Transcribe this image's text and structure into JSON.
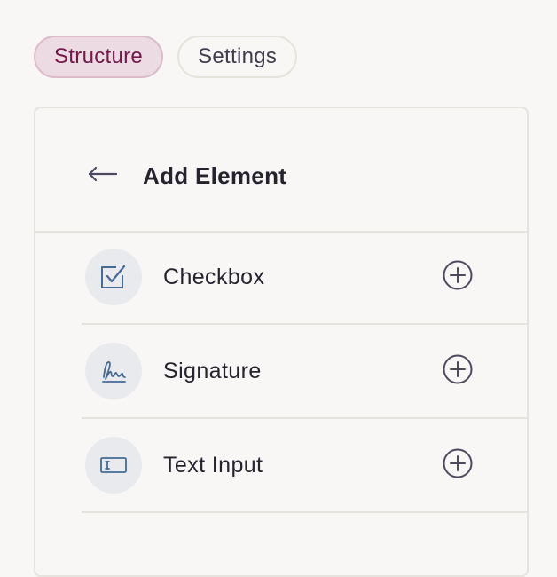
{
  "tabs": [
    {
      "label": "Structure",
      "active": true
    },
    {
      "label": "Settings",
      "active": false
    }
  ],
  "panel": {
    "title": "Add Element",
    "back_icon": "arrow-left-icon",
    "items": [
      {
        "label": "Checkbox",
        "icon": "checkbox-icon",
        "action_icon": "plus-circle-icon"
      },
      {
        "label": "Signature",
        "icon": "signature-icon",
        "action_icon": "plus-circle-icon"
      },
      {
        "label": "Text Input",
        "icon": "text-input-icon",
        "action_icon": "plus-circle-icon"
      }
    ]
  },
  "colors": {
    "background": "#f8f7f5",
    "active_tab_bg": "#ecdbe2",
    "active_tab_text": "#74174a",
    "icon_blue": "#476a96",
    "icon_circle_bg": "#e9eaee",
    "plus_icon": "#4d4a60"
  }
}
